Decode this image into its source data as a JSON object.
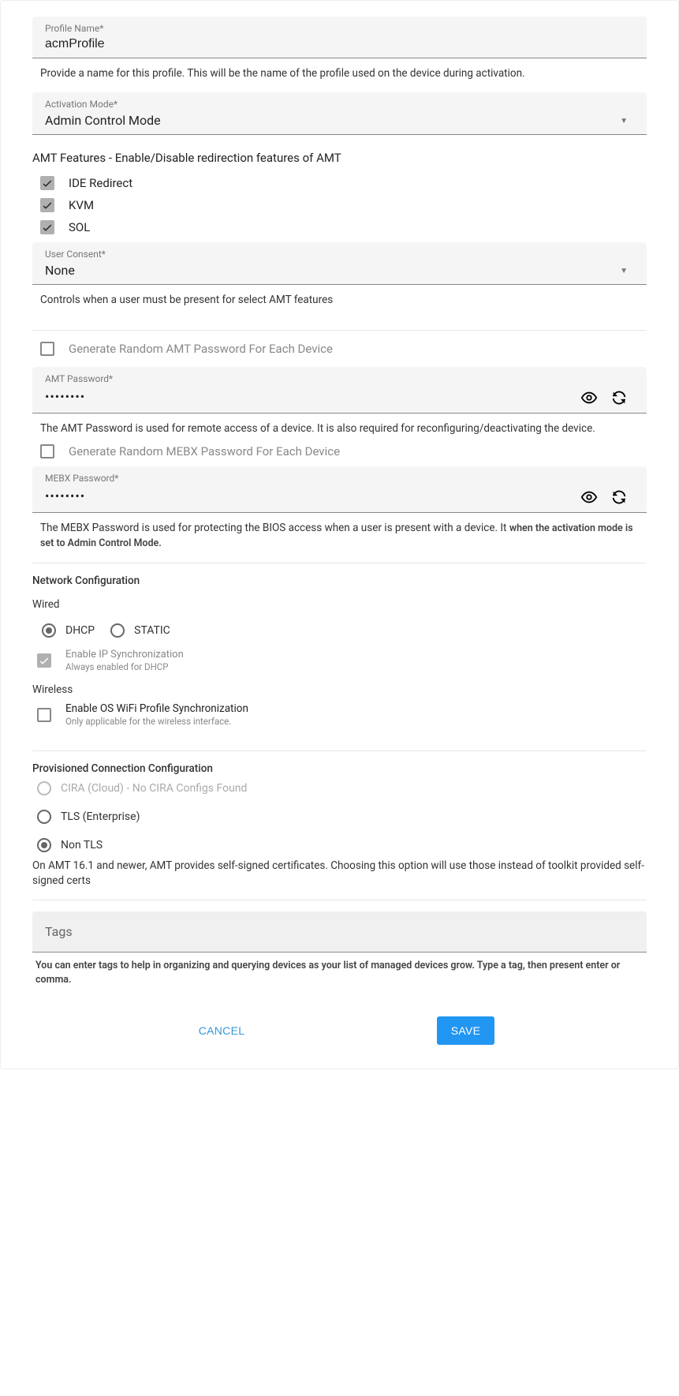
{
  "profileName": {
    "label": "Profile Name*",
    "value": "acmProfile",
    "hint": "Provide a name for this profile. This will be the name of the profile used on the device during activation."
  },
  "activationMode": {
    "label": "Activation Mode*",
    "value": "Admin Control Mode"
  },
  "amtFeatures": {
    "heading": "AMT Features - Enable/Disable redirection features of AMT",
    "ide": "IDE Redirect",
    "kvm": "KVM",
    "sol": "SOL"
  },
  "userConsent": {
    "label": "User Consent*",
    "value": "None",
    "hint": "Controls when a user must be present for select AMT features"
  },
  "generateAmt": "Generate Random AMT Password For Each Device",
  "amtPassword": {
    "label": "AMT Password*",
    "value": "••••••••",
    "hint": "The AMT Password is used for remote access of a device. It is also required for reconfiguring/deactivating the device."
  },
  "generateMebx": "Generate Random MEBX Password For Each Device",
  "mebxPassword": {
    "label": "MEBX Password*",
    "value": "••••••••",
    "hint1": "The MEBX Password is used for protecting the BIOS access when a user is present with a device. It",
    "hint2": "when the activation mode is set to Admin Control Mode."
  },
  "network": {
    "heading": "Network Configuration",
    "wired": "Wired",
    "dhcp": "DHCP",
    "static": "STATIC",
    "ipSync": "Enable IP Synchronization",
    "ipSyncSub": "Always enabled for DHCP",
    "wireless": "Wireless",
    "wifiSync": "Enable OS WiFi Profile Synchronization",
    "wifiSyncSub": "Only applicable for the wireless interface."
  },
  "prov": {
    "heading": "Provisioned Connection Configuration",
    "cira": "CIRA (Cloud) - No CIRA Configs Found",
    "tls": "TLS (Enterprise)",
    "nontls": "Non TLS",
    "note": "On AMT 16.1 and newer, AMT provides self-signed certificates. Choosing this option will use those instead of toolkit provided self-signed certs"
  },
  "tags": {
    "placeholder": "Tags",
    "hint": "You can enter tags to help in organizing and querying devices as your list of managed devices grow. Type a tag, then present enter or comma."
  },
  "actions": {
    "cancel": "CANCEL",
    "save": "SAVE"
  }
}
